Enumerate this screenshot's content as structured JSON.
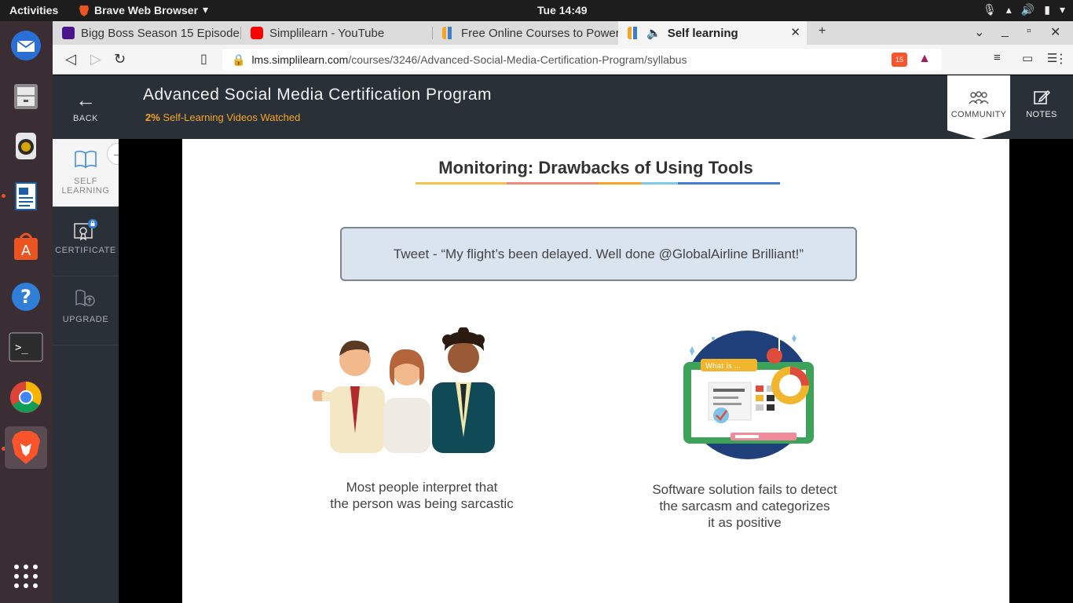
{
  "system": {
    "activities": "Activities",
    "app_menu": "Brave Web Browser",
    "clock": "Tue 14:49"
  },
  "browser": {
    "tabs": [
      {
        "label": "Bigg Boss Season 15 Episode",
        "favicon_color": "#4a148c"
      },
      {
        "label": "Simplilearn - YouTube",
        "favicon_color": "#ff0000"
      },
      {
        "label": "Free Online Courses to Power",
        "favicon_color": "#f6a623"
      },
      {
        "label": "Self learning",
        "favicon_color": "#f6a623"
      }
    ],
    "url_host": "lms.simplilearn.com",
    "url_path": "/courses/3246/Advanced-Social-Media-Certification-Program/syllabus",
    "shield_count": "15"
  },
  "header": {
    "back_label": "BACK",
    "title": "Advanced Social Media Certification Program",
    "progress_value": "2%",
    "progress_text": "Self-Learning Videos Watched",
    "community_label": "COMMUNITY",
    "notes_label": "NOTES"
  },
  "sidebar": {
    "items": [
      {
        "label_line1": "SELF",
        "label_line2": "LEARNING"
      },
      {
        "label": "CERTIFICATE"
      },
      {
        "label": "UPGRADE"
      }
    ]
  },
  "slide": {
    "title": "Monitoring: Drawbacks of Using Tools",
    "tweet": "Tweet - “My flight’s been delayed. Well done @GlobalAirline Brilliant!”",
    "left_caption_l1": "Most people interpret that",
    "left_caption_l2": "the person was being sarcastic",
    "right_caption_l1": "Software solution fails to detect",
    "right_caption_l2": "the sarcasm and categorizes",
    "right_caption_l3": "it as positive",
    "screen_search_text": "What is ..."
  },
  "colors": {
    "accent_orange": "#f6a623",
    "header_bg": "#2a3038",
    "tweet_bg": "#d9e4ef"
  }
}
